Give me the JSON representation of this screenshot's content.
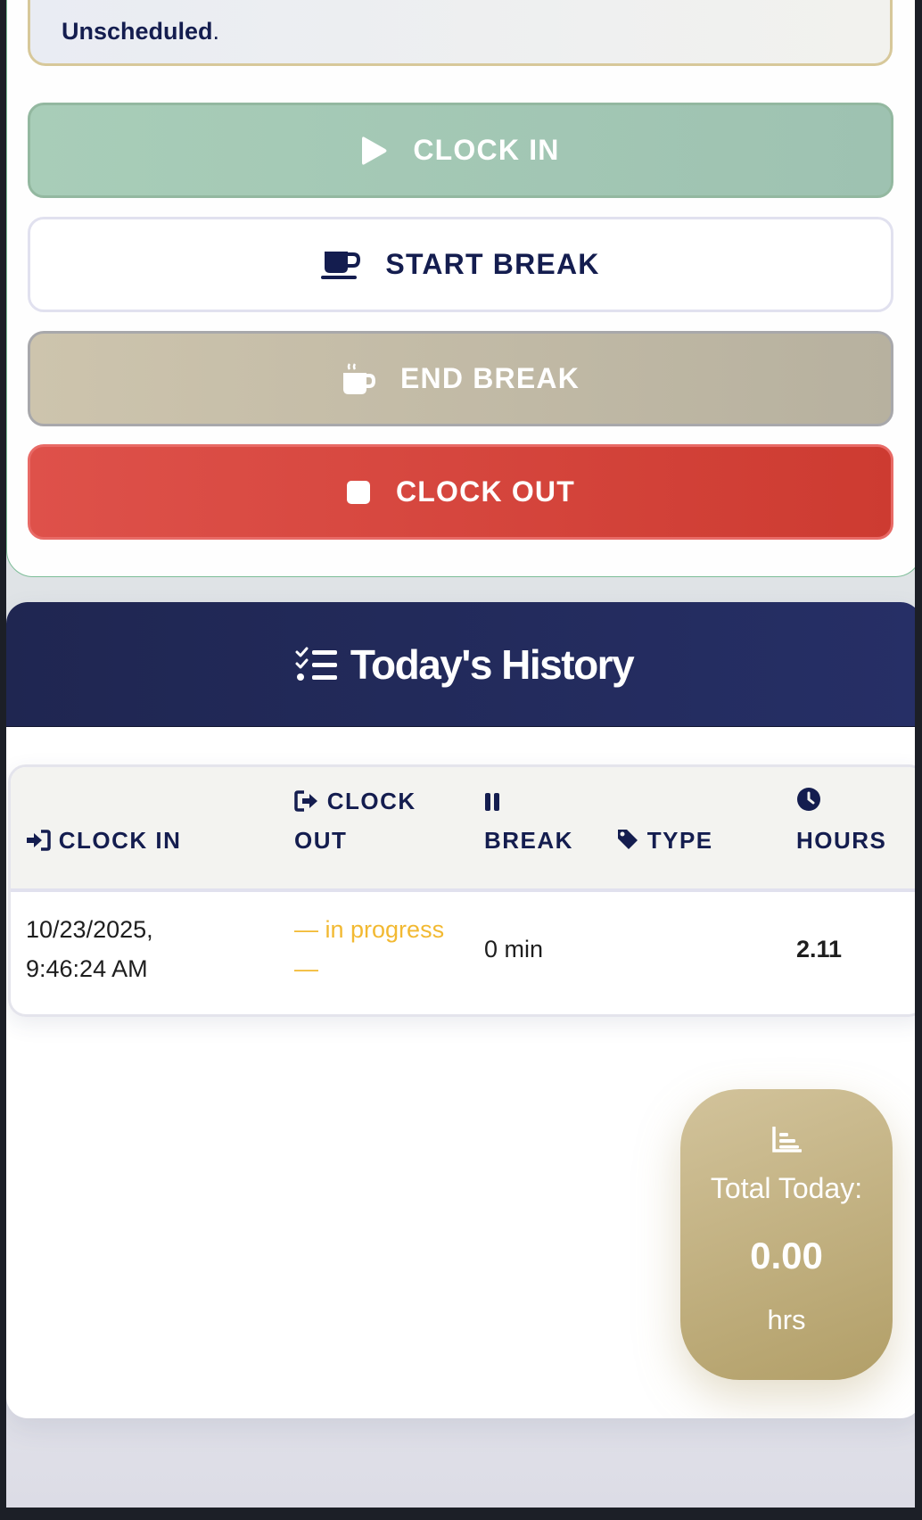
{
  "notice": {
    "bold": "Unscheduled",
    "suffix": "."
  },
  "buttons": {
    "clock_in": "CLOCK IN",
    "start_break": "START BREAK",
    "end_break": "END BREAK",
    "clock_out": "CLOCK OUT"
  },
  "colors": {
    "clock_in": "#a3c8b4",
    "end_break": "#c2bba6",
    "clock_out": "#d6443c",
    "navy": "#141d4f",
    "gold": "#c2b17f",
    "in_progress": "#f2b932"
  },
  "history": {
    "title": "Today's History",
    "columns": {
      "clock_in": "CLOCK IN",
      "clock_out_1": "CLOCK",
      "clock_out_2": "OUT",
      "break": "BREAK",
      "type": "TYPE",
      "hours": "HOURS"
    },
    "rows": [
      {
        "clock_in_date": "10/23/2025,",
        "clock_in_time": "9:46:24 AM",
        "clock_out_1": "— in progress",
        "clock_out_2": "—",
        "break": "0 min",
        "type": "",
        "hours": "2.11"
      }
    ]
  },
  "total": {
    "label": "Total Today:",
    "value": "0.00",
    "unit": "hrs"
  },
  "icons": [
    "play-icon",
    "mug-icon",
    "hot-mug-icon",
    "stop-icon",
    "list-check-icon",
    "sign-in-icon",
    "sign-out-icon",
    "pause-icon",
    "tag-icon",
    "clock-icon",
    "chart-icon"
  ]
}
